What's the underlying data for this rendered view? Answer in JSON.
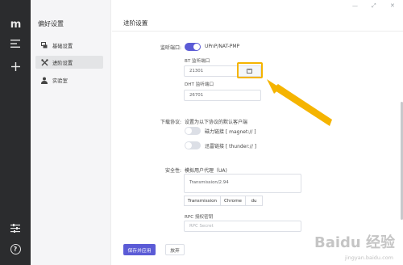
{
  "rail": {
    "logo": "m"
  },
  "nav": {
    "title": "偏好设置",
    "items": [
      {
        "label": "基础设置"
      },
      {
        "label": "进阶设置"
      },
      {
        "label": "实验室"
      }
    ]
  },
  "main": {
    "title": "进阶设置",
    "listen_port": {
      "label": "监听端口:",
      "upnp_label": "UPnP/NAT-PMP",
      "bt_label": "BT 监听端口",
      "bt_value": "21301",
      "dht_label": "DHT 监听端口",
      "dht_value": "26701"
    },
    "protocol": {
      "label": "下载协议:",
      "hint": "设置为以下协议的默认客户端",
      "magnet": "磁力链接 [ magnet:// ]",
      "thunder": "迅雷链接 [ thunder:// ]"
    },
    "security": {
      "label": "安全性:",
      "ua_label": "模拟用户代理（UA)",
      "ua_value": "Transmission/2.94",
      "ua_buttons": [
        "Transmission",
        "Chrome",
        "du"
      ],
      "rpc_label": "RPC 授权密钥",
      "rpc_placeholder": "RPC Secret"
    },
    "actions": {
      "save": "保存并应用",
      "discard": "放弃"
    }
  },
  "watermark": {
    "text": "Baidu 经验",
    "sub": "jingyan.baidu.com"
  },
  "colors": {
    "accent": "#5b5bd6",
    "rail": "#2b2c2e",
    "highlight": "#f5b400"
  }
}
